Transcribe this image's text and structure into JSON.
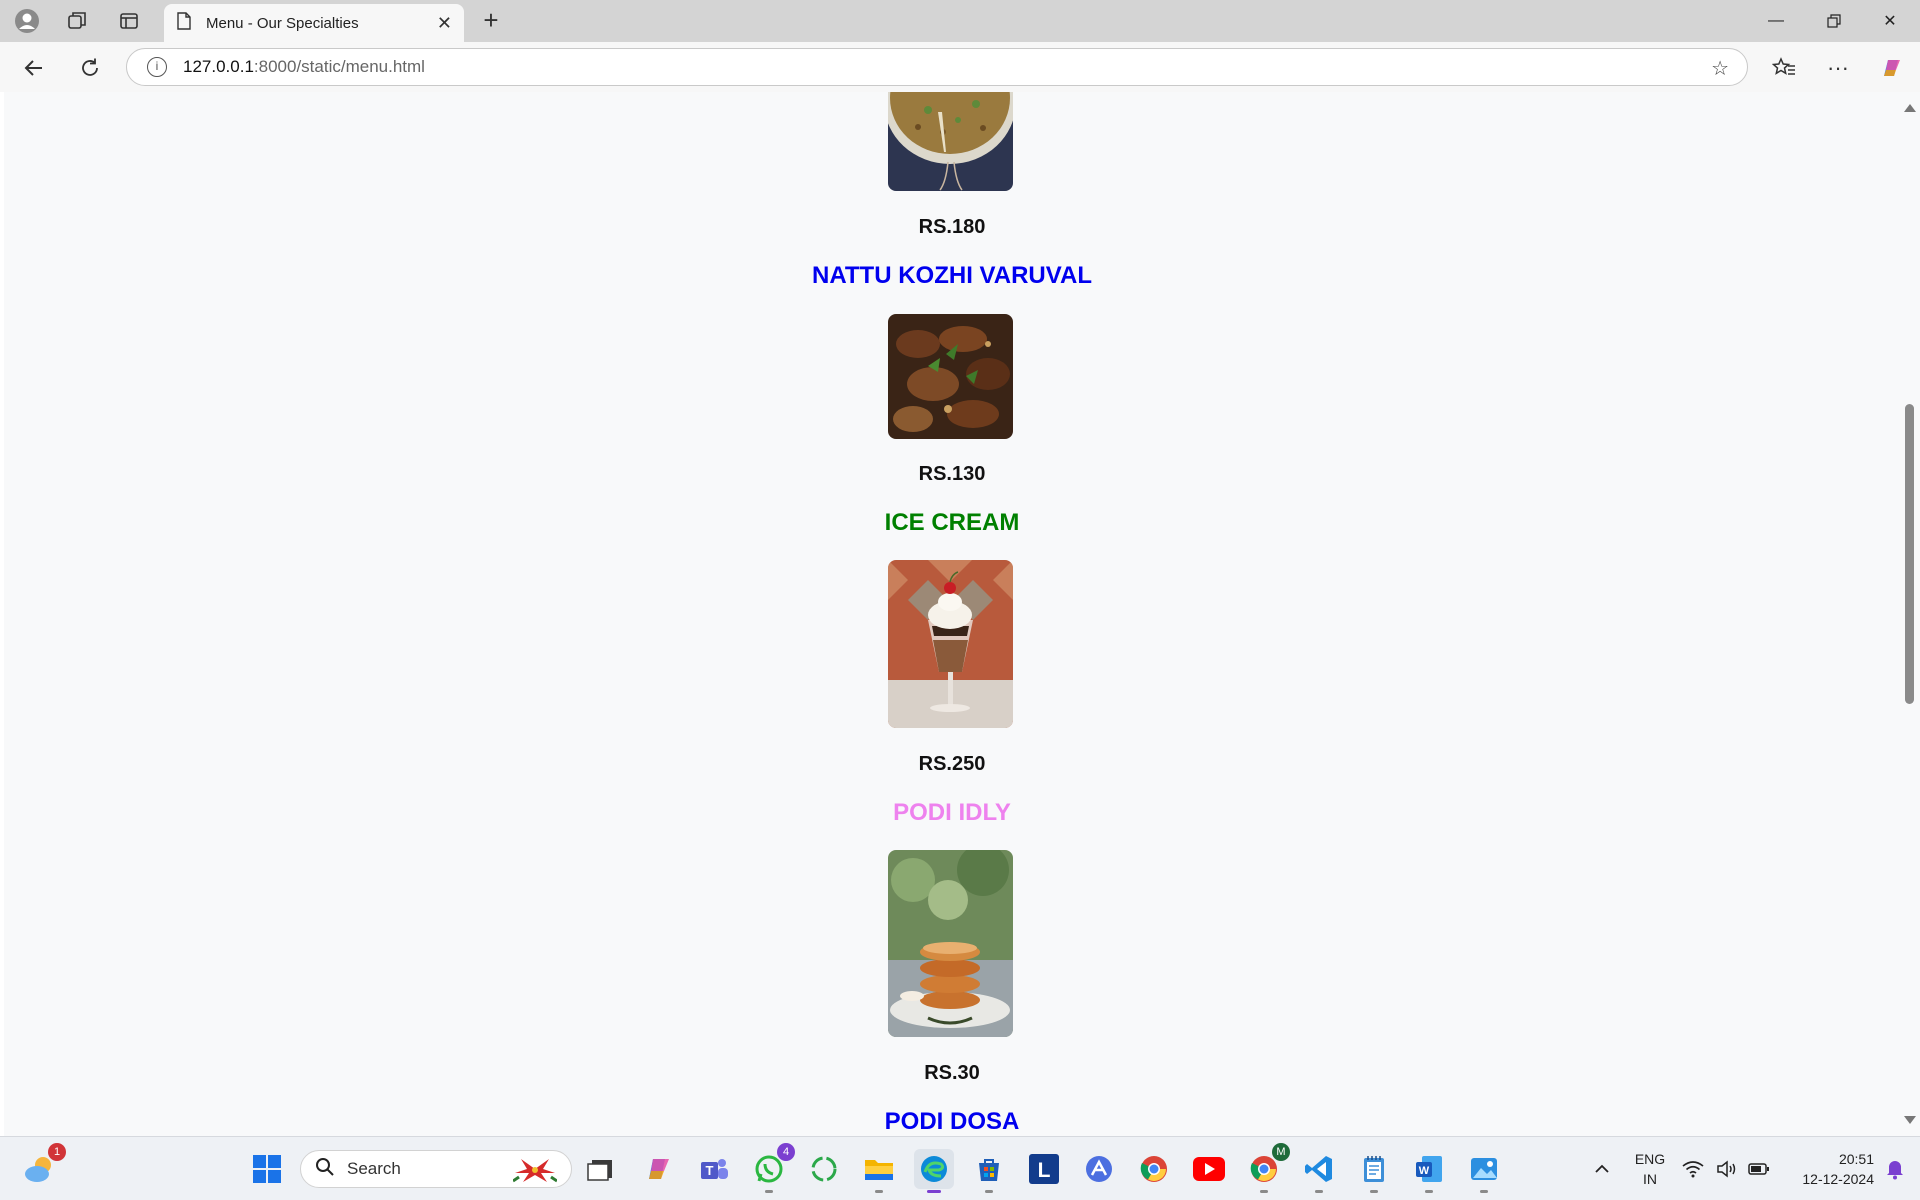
{
  "browser": {
    "tab_title": "Menu - Our Specialties",
    "url_host": "127.0.0.1",
    "url_path": ":8000/static/menu.html"
  },
  "menu": {
    "items": [
      {
        "name": "",
        "price": "RS.180",
        "name_color": "#0000ee"
      },
      {
        "name": "NATTU KOZHI VARUVAL",
        "price": "RS.130",
        "name_color": "#0000ee"
      },
      {
        "name": "ICE CREAM",
        "price": "RS.250",
        "name_color": "#008000"
      },
      {
        "name": "PODI IDLY",
        "price": "RS.30",
        "name_color": "#ee82ee"
      },
      {
        "name": "PODI DOSA",
        "price": "",
        "name_color": "#0000ee"
      }
    ]
  },
  "taskbar": {
    "search_label": "Search",
    "weather_badge": "1",
    "whatsapp_badge": "4",
    "chrome_profile_badge": "M",
    "lang_primary": "ENG",
    "lang_secondary": "IN",
    "time": "20:51",
    "date": "12-12-2024"
  }
}
